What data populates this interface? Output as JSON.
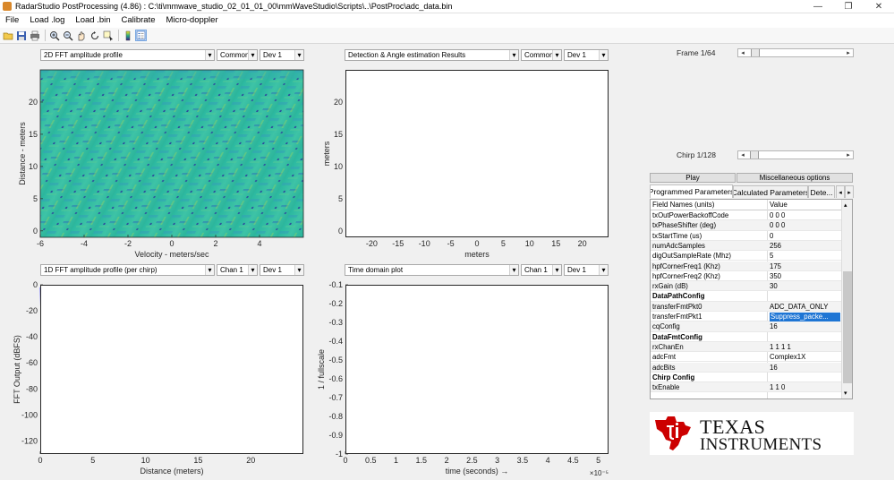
{
  "window": {
    "title": "RadarStudio PostProcessing (4.86)  : C:\\ti\\mmwave_studio_02_01_01_00\\mmWaveStudio\\Scripts\\..\\PostProc\\adc_data.bin",
    "min_glyph": "—",
    "max_glyph": "❐",
    "close_glyph": "✕"
  },
  "menu": [
    "File",
    "Load .log",
    "Load .bin",
    "Calibrate",
    "Micro-doppler"
  ],
  "toolbar_icons": [
    "open-icon",
    "save-icon",
    "print-icon",
    "zoom-in-icon",
    "zoom-out-icon",
    "pan-icon",
    "rotate-icon",
    "data-cursor-icon",
    "colorbar-icon",
    "legend-icon"
  ],
  "panels": {
    "fft2d": {
      "selector": "2D FFT amplitude profile",
      "mode": "Common",
      "device": "Dev 1",
      "xlabel": "Velocity - meters/sec",
      "ylabel": "Distance - meters",
      "xticks": [
        "-6",
        "-4",
        "-2",
        "0",
        "2",
        "4"
      ],
      "yticks": [
        "0",
        "5",
        "10",
        "15",
        "20"
      ],
      "xlim": [
        -6,
        6
      ],
      "ylim": [
        -1,
        25
      ]
    },
    "detection": {
      "selector": "Detection & Angle estimation Results",
      "mode": "Common",
      "device": "Dev 1",
      "xlabel": "meters",
      "ylabel": "meters",
      "xticks": [
        "-20",
        "-15",
        "-10",
        "-5",
        "0",
        "5",
        "10",
        "15",
        "20"
      ],
      "yticks": [
        "0",
        "5",
        "10",
        "15",
        "20"
      ],
      "xlim": [
        -25,
        25
      ],
      "ylim": [
        -1,
        25
      ],
      "point": [
        0,
        0
      ]
    },
    "fft1d": {
      "selector": "1D FFT amplitude profile (per chirp)",
      "channel": "Chan 1",
      "device": "Dev 1",
      "xlabel": "Distance (meters)",
      "ylabel": "FFT Output (dBFS)",
      "xticks": [
        "0",
        "5",
        "10",
        "15",
        "20"
      ],
      "yticks": [
        "0",
        "-20",
        "-40",
        "-60",
        "-80",
        "-100",
        "-120"
      ],
      "xlim": [
        0,
        25
      ],
      "ylim": [
        -130,
        0
      ],
      "line_color": "#2020ff"
    },
    "timedomain": {
      "selector": "Time domain plot",
      "channel": "Chan 1",
      "device": "Dev 1",
      "xlabel": "time  (seconds) →",
      "ylabel": "1 / fullscale",
      "xexp": "×10⁻⁵",
      "xticks": [
        "0",
        "0.5",
        "1",
        "1.5",
        "2",
        "2.5",
        "3",
        "3.5",
        "4",
        "4.5",
        "5"
      ],
      "yticks": [
        "-0.1",
        "-0.2",
        "-0.3",
        "-0.4",
        "-0.5",
        "-0.6",
        "-0.7",
        "-0.8",
        "-0.9",
        "-1"
      ],
      "xlim": [
        0,
        5.2
      ],
      "ylim": [
        -1,
        -0.1
      ],
      "legend": [
        {
          "label": "real",
          "color": "#2020ff"
        },
        {
          "label": "imag",
          "color": "#e02020"
        }
      ],
      "real_level": -0.91,
      "imag_level": -0.11
    }
  },
  "frame": {
    "label": "Frame 1/64",
    "fraction": 0.02
  },
  "chirp": {
    "label": "Chirp 1/128",
    "fraction": 0.01
  },
  "buttons": {
    "play": "Play",
    "misc": "Miscellaneous options"
  },
  "tabs": [
    "Programmed Parameters",
    "Calculated Parameters",
    "Dete..."
  ],
  "table": {
    "headers": [
      "Field Names   (units)",
      "Value"
    ],
    "rows": [
      {
        "name": "txOutPowerBackoffCode",
        "value": "0 0 0"
      },
      {
        "name": "txPhaseShifter (deg)",
        "value": "0 0 0"
      },
      {
        "name": "txStartTime (us)",
        "value": "0"
      },
      {
        "name": "numAdcSamples",
        "value": "256"
      },
      {
        "name": "digOutSampleRate (Mhz)",
        "value": "5"
      },
      {
        "name": "hpfCornerFreq1 (Khz)",
        "value": "175"
      },
      {
        "name": "hpfCornerFreq2 (Khz)",
        "value": "350"
      },
      {
        "name": "rxGain (dB)",
        "value": "30"
      },
      {
        "name": "DataPathConfig",
        "value": "",
        "section": true
      },
      {
        "name": "transferFmtPkt0",
        "value": "ADC_DATA_ONLY"
      },
      {
        "name": "transferFmtPkt1",
        "value": "Suppress_packe...",
        "selected": true
      },
      {
        "name": "cqConfig",
        "value": "16"
      },
      {
        "name": "DataFmtConfig",
        "value": "",
        "section": true
      },
      {
        "name": "rxChanEn",
        "value": "1 1 1 1"
      },
      {
        "name": "adcFmt",
        "value": "Complex1X"
      },
      {
        "name": "adcBits",
        "value": "16"
      },
      {
        "name": "Chirp Config",
        "value": "",
        "section": true
      },
      {
        "name": "txEnable",
        "value": "1 1 0"
      }
    ]
  },
  "logo": {
    "line1": "TEXAS",
    "line2": "INSTRUMENTS",
    "color": "#cc0000"
  }
}
